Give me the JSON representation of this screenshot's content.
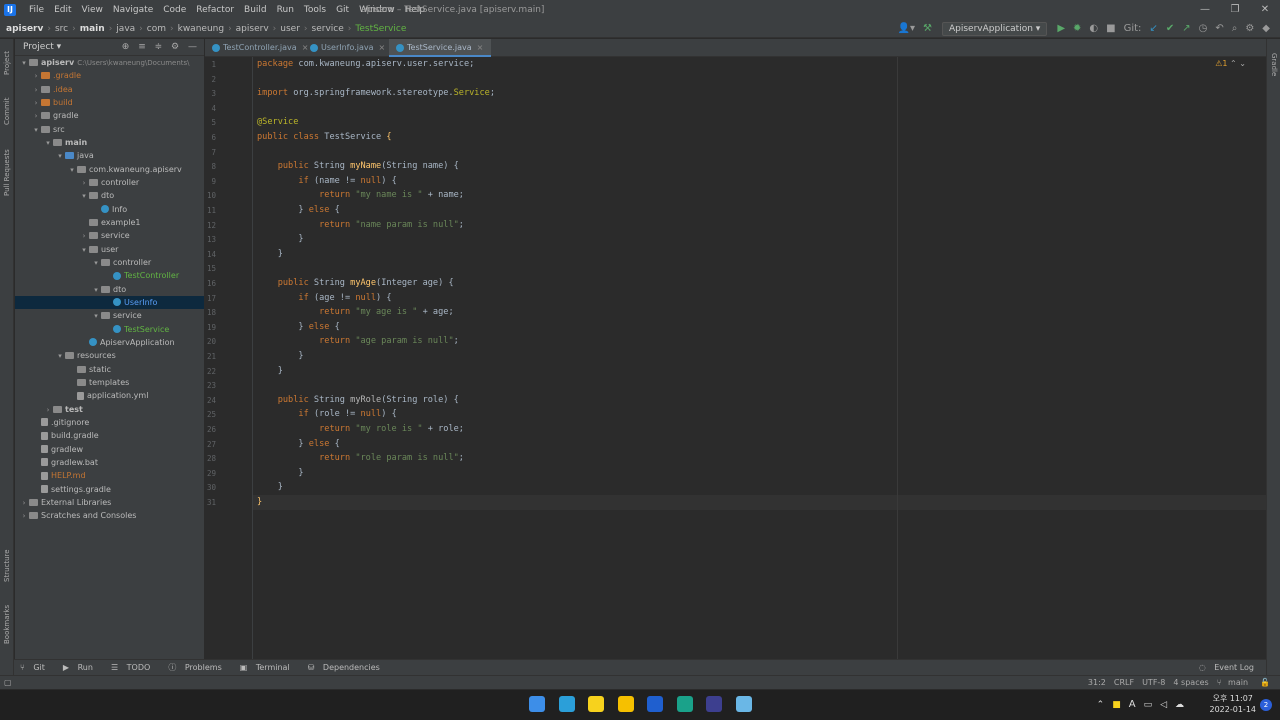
{
  "app": {
    "logo": "IJ",
    "menus": [
      "File",
      "Edit",
      "View",
      "Navigate",
      "Code",
      "Refactor",
      "Build",
      "Run",
      "Tools",
      "Git",
      "Window",
      "Help"
    ],
    "title": "apiserv – TestService.java [apiserv.main]",
    "controls": [
      "minimize-icon",
      "restore-icon",
      "close-icon"
    ]
  },
  "breadcrumbs": [
    "apiserv",
    "src",
    "main",
    "java",
    "com",
    "kwaneung",
    "apiserv",
    "user",
    "service",
    "TestService"
  ],
  "toolbar": {
    "run_config": "ApiservApplication",
    "git_label": "Git:"
  },
  "project": {
    "title": "Project",
    "tree": [
      {
        "depth": 0,
        "arrow": "▾",
        "icon": "folder-icon",
        "label": "apiserv",
        "extra": "C:\\Users\\kwaneung\\Documents\\",
        "color": "bold"
      },
      {
        "depth": 1,
        "arrow": "›",
        "icon": "orange",
        "label": ".gradle",
        "color": "orange"
      },
      {
        "depth": 1,
        "arrow": "›",
        "icon": "folder",
        "label": ".idea",
        "color": "orange"
      },
      {
        "depth": 1,
        "arrow": "›",
        "icon": "orange",
        "label": "build",
        "color": "orange"
      },
      {
        "depth": 1,
        "arrow": "›",
        "icon": "folder",
        "label": "gradle",
        "color": ""
      },
      {
        "depth": 1,
        "arrow": "▾",
        "icon": "folder",
        "label": "src",
        "color": ""
      },
      {
        "depth": 2,
        "arrow": "▾",
        "icon": "folder",
        "label": "main",
        "color": "bold"
      },
      {
        "depth": 3,
        "arrow": "▾",
        "icon": "src",
        "label": "java",
        "color": ""
      },
      {
        "depth": 4,
        "arrow": "▾",
        "icon": "folder",
        "label": "com.kwaneung.apiserv",
        "color": ""
      },
      {
        "depth": 5,
        "arrow": "›",
        "icon": "folder",
        "label": "controller",
        "color": ""
      },
      {
        "depth": 5,
        "arrow": "▾",
        "icon": "folder",
        "label": "dto",
        "color": ""
      },
      {
        "depth": 6,
        "arrow": "",
        "icon": "cls",
        "label": "Info",
        "color": ""
      },
      {
        "depth": 5,
        "arrow": "",
        "icon": "folder",
        "label": "example1",
        "color": ""
      },
      {
        "depth": 5,
        "arrow": "›",
        "icon": "folder",
        "label": "service",
        "color": ""
      },
      {
        "depth": 5,
        "arrow": "▾",
        "icon": "folder",
        "label": "user",
        "color": ""
      },
      {
        "depth": 6,
        "arrow": "▾",
        "icon": "folder",
        "label": "controller",
        "color": ""
      },
      {
        "depth": 7,
        "arrow": "",
        "icon": "cls",
        "label": "TestController",
        "color": "green"
      },
      {
        "depth": 6,
        "arrow": "▾",
        "icon": "folder",
        "label": "dto",
        "color": ""
      },
      {
        "depth": 7,
        "arrow": "",
        "icon": "cls",
        "label": "UserInfo",
        "color": "blue",
        "selected": true
      },
      {
        "depth": 6,
        "arrow": "▾",
        "icon": "folder",
        "label": "service",
        "color": ""
      },
      {
        "depth": 7,
        "arrow": "",
        "icon": "cls",
        "label": "TestService",
        "color": "green"
      },
      {
        "depth": 5,
        "arrow": "",
        "icon": "cls",
        "label": "ApiservApplication",
        "color": ""
      },
      {
        "depth": 3,
        "arrow": "▾",
        "icon": "folder",
        "label": "resources",
        "color": ""
      },
      {
        "depth": 4,
        "arrow": "",
        "icon": "folder",
        "label": "static",
        "color": ""
      },
      {
        "depth": 4,
        "arrow": "",
        "icon": "folder",
        "label": "templates",
        "color": ""
      },
      {
        "depth": 4,
        "arrow": "",
        "icon": "file",
        "label": "application.yml",
        "color": ""
      },
      {
        "depth": 2,
        "arrow": "›",
        "icon": "folder",
        "label": "test",
        "color": "bold"
      },
      {
        "depth": 1,
        "arrow": "",
        "icon": "file",
        "label": ".gitignore",
        "color": ""
      },
      {
        "depth": 1,
        "arrow": "",
        "icon": "file",
        "label": "build.gradle",
        "color": ""
      },
      {
        "depth": 1,
        "arrow": "",
        "icon": "file",
        "label": "gradlew",
        "color": ""
      },
      {
        "depth": 1,
        "arrow": "",
        "icon": "file",
        "label": "gradlew.bat",
        "color": ""
      },
      {
        "depth": 1,
        "arrow": "",
        "icon": "file",
        "label": "HELP.md",
        "color": "orange"
      },
      {
        "depth": 1,
        "arrow": "",
        "icon": "file",
        "label": "settings.gradle",
        "color": ""
      },
      {
        "depth": 0,
        "arrow": "›",
        "icon": "folder",
        "label": "External Libraries",
        "color": ""
      },
      {
        "depth": 0,
        "arrow": "›",
        "icon": "folder",
        "label": "Scratches and Consoles",
        "color": ""
      }
    ]
  },
  "left_tabs": [
    "Project",
    "Commit",
    "Pull Requests",
    "Structure",
    "Bookmarks"
  ],
  "right_tabs": [
    "Gradle"
  ],
  "editor": {
    "tabs": [
      {
        "label": "TestController.java",
        "active": false
      },
      {
        "label": "UserInfo.java",
        "active": false
      },
      {
        "label": "TestService.java",
        "active": true
      }
    ],
    "warnings": "⚠1",
    "lines": [
      [
        [
          "kw",
          "package "
        ],
        [
          "",
          "com.kwaneung.apiserv.user.service;"
        ]
      ],
      [],
      [
        [
          "kw",
          "import "
        ],
        [
          "",
          "org.springframework.stereotype."
        ],
        [
          "an",
          "Service"
        ],
        [
          "",
          ";"
        ]
      ],
      [],
      [
        [
          "an",
          "@Service"
        ]
      ],
      [
        [
          "kw",
          "public class "
        ],
        [
          "",
          "TestService "
        ],
        [
          "fn",
          "{"
        ]
      ],
      [],
      [
        [
          "",
          "    "
        ],
        [
          "kw",
          "public "
        ],
        [
          "",
          "String "
        ],
        [
          "fn",
          "myName"
        ],
        [
          "",
          "(String name) {"
        ]
      ],
      [
        [
          "",
          "        "
        ],
        [
          "kw",
          "if "
        ],
        [
          "",
          "(name != "
        ],
        [
          "kw",
          "null"
        ],
        [
          "",
          ") {"
        ]
      ],
      [
        [
          "",
          "            "
        ],
        [
          "kw",
          "return "
        ],
        [
          "st",
          "\"my name is \""
        ],
        [
          "",
          " + name;"
        ]
      ],
      [
        [
          "",
          "        } "
        ],
        [
          "kw",
          "else "
        ],
        [
          "",
          "{"
        ]
      ],
      [
        [
          "",
          "            "
        ],
        [
          "kw",
          "return "
        ],
        [
          "st",
          "\"name param is null\""
        ],
        [
          "",
          ";"
        ]
      ],
      [
        [
          "",
          "        }"
        ]
      ],
      [
        [
          "",
          "    }"
        ]
      ],
      [],
      [
        [
          "",
          "    "
        ],
        [
          "kw",
          "public "
        ],
        [
          "",
          "String "
        ],
        [
          "fn",
          "myAge"
        ],
        [
          "",
          "(Integer age) {"
        ]
      ],
      [
        [
          "",
          "        "
        ],
        [
          "kw",
          "if "
        ],
        [
          "",
          "(age != "
        ],
        [
          "kw",
          "null"
        ],
        [
          "",
          ") {"
        ]
      ],
      [
        [
          "",
          "            "
        ],
        [
          "kw",
          "return "
        ],
        [
          "st",
          "\"my age is \""
        ],
        [
          "",
          " + age;"
        ]
      ],
      [
        [
          "",
          "        } "
        ],
        [
          "kw",
          "else "
        ],
        [
          "",
          "{"
        ]
      ],
      [
        [
          "",
          "            "
        ],
        [
          "kw",
          "return "
        ],
        [
          "st",
          "\"age param is null\""
        ],
        [
          "",
          ";"
        ]
      ],
      [
        [
          "",
          "        }"
        ]
      ],
      [
        [
          "",
          "    }"
        ]
      ],
      [],
      [
        [
          "",
          "    "
        ],
        [
          "kw",
          "public "
        ],
        [
          "",
          "String "
        ],
        [
          "fnm",
          "myRole"
        ],
        [
          "",
          "(String role) {"
        ]
      ],
      [
        [
          "",
          "        "
        ],
        [
          "kw",
          "if "
        ],
        [
          "",
          "(role != "
        ],
        [
          "kw",
          "null"
        ],
        [
          "",
          ") {"
        ]
      ],
      [
        [
          "",
          "            "
        ],
        [
          "kw",
          "return "
        ],
        [
          "st",
          "\"my role is \""
        ],
        [
          "",
          " + role;"
        ]
      ],
      [
        [
          "",
          "        } "
        ],
        [
          "kw",
          "else "
        ],
        [
          "",
          "{"
        ]
      ],
      [
        [
          "",
          "            "
        ],
        [
          "kw",
          "return "
        ],
        [
          "st",
          "\"role param is null\""
        ],
        [
          "",
          ";"
        ]
      ],
      [
        [
          "",
          "        }"
        ]
      ],
      [
        [
          "",
          "    }"
        ]
      ],
      [
        [
          "fn",
          "}"
        ]
      ]
    ],
    "current_line": 31
  },
  "bottom_tools": [
    "Git",
    "Run",
    "TODO",
    "Problems",
    "Terminal",
    "Dependencies"
  ],
  "event_log": "Event Log",
  "status": {
    "position": "31:2",
    "line_sep": "CRLF",
    "encoding": "UTF-8",
    "indent": "4 spaces",
    "branch": "main"
  },
  "taskbar": {
    "clock_ampm": "오후 11:07",
    "date": "2022-01-14",
    "notifications": "2",
    "apps": [
      {
        "icon": "windows-start-icon",
        "color": "#3d8ee8"
      },
      {
        "icon": "bird-app-icon",
        "color": "#2b9fd9"
      },
      {
        "icon": "kakaotalk-icon",
        "color": "#f7d21d"
      },
      {
        "icon": "sticky-notes-icon",
        "color": "#f6c000"
      },
      {
        "icon": "intellij-icon",
        "color": "#1f5fcf"
      },
      {
        "icon": "globe-app-icon",
        "color": "#1aa28a"
      },
      {
        "icon": "eclipse-icon",
        "color": "#3d3f8f"
      },
      {
        "icon": "notepad-icon",
        "color": "#6ab7e6"
      }
    ]
  }
}
